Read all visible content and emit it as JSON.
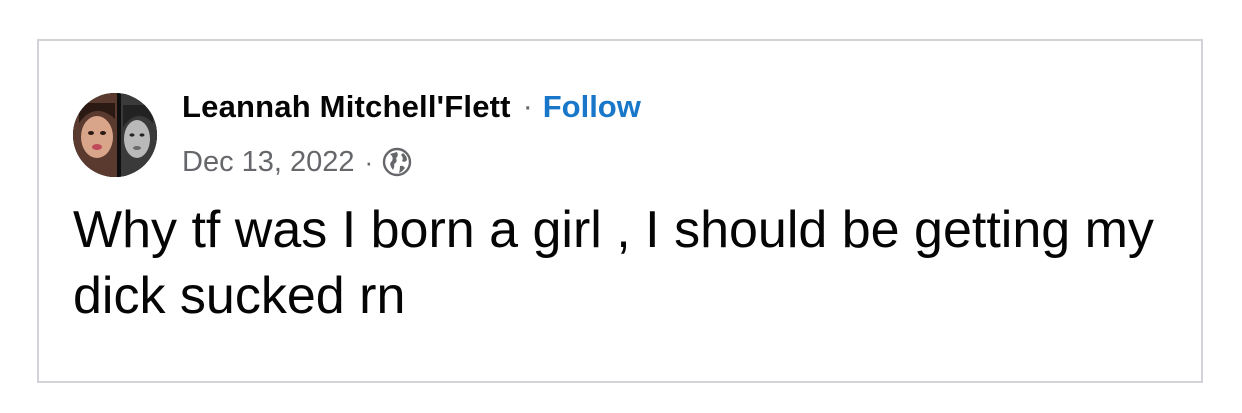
{
  "post": {
    "author_name": "Leannah Mitchell'Flett",
    "separator": "·",
    "follow_label": "Follow",
    "date": "Dec 13, 2022",
    "meta_separator": "·",
    "privacy_icon": "globe-icon",
    "text": "Why tf was I born a girl , I should be getting my dick sucked rn"
  },
  "colors": {
    "border": "#d3d3d7",
    "follow": "#1877c9",
    "meta_text": "#65676b",
    "body_text": "#050505"
  }
}
